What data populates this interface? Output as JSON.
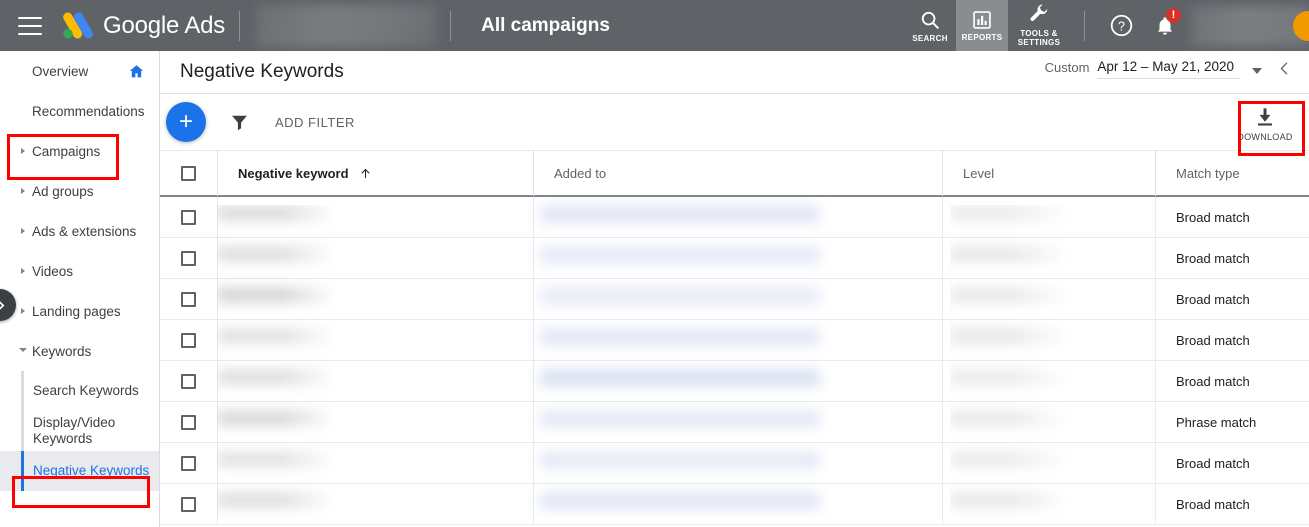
{
  "topbar": {
    "menu_icon": "hamburger-icon",
    "brand": "Google Ads",
    "brand_logo_icon": "google-ads-logo-icon",
    "account_section": "All campaigns",
    "items": [
      {
        "label": "SEARCH",
        "icon": "search-icon",
        "active": false
      },
      {
        "label": "REPORTS",
        "icon": "bar-chart-icon",
        "active": true
      },
      {
        "label": "TOOLS & SETTINGS",
        "icon": "wrench-icon",
        "active": false
      }
    ],
    "help_icon": "help-icon",
    "notifications_icon": "bell-icon",
    "notification_badge": "!",
    "avatar_icon": "avatar"
  },
  "sidebar": {
    "collapse_icon": "chevron-right-icon",
    "items": [
      {
        "label": "Overview",
        "expandable": false,
        "home_icon": "home-icon"
      },
      {
        "label": "Recommendations",
        "expandable": false
      },
      {
        "label": "Campaigns",
        "expandable": true,
        "expanded": false
      },
      {
        "label": "Ad groups",
        "expandable": true,
        "expanded": false
      },
      {
        "label": "Ads & extensions",
        "expandable": true,
        "expanded": false
      },
      {
        "label": "Videos",
        "expandable": true,
        "expanded": false
      },
      {
        "label": "Landing pages",
        "expandable": true,
        "expanded": false
      },
      {
        "label": "Keywords",
        "expandable": true,
        "expanded": true
      }
    ],
    "keywords_children": [
      {
        "label": "Search Keywords",
        "selected": false
      },
      {
        "label": "Display/Video Keywords",
        "selected": false
      },
      {
        "label": "Negative Keywords",
        "selected": true
      }
    ]
  },
  "page": {
    "title": "Negative Keywords",
    "date_range_label": "Custom",
    "date_range_value": "Apr 12 – May 21, 2020",
    "date_range_caret_icon": "chevron-down-icon",
    "date_prev_icon": "chevron-left-icon"
  },
  "toolbar": {
    "add_icon": "plus-icon",
    "filter_icon": "funnel-icon",
    "add_filter_label": "ADD FILTER",
    "download_icon": "download-icon",
    "download_label": "DOWNLOAD"
  },
  "table": {
    "select_all_checkbox": "unchecked",
    "columns": [
      {
        "label": "Negative keyword",
        "sorted": true,
        "sort_icon": "arrow-up-icon"
      },
      {
        "label": "Added to",
        "sorted": false
      },
      {
        "label": "Level",
        "sorted": false
      },
      {
        "label": "Match type",
        "sorted": false
      }
    ],
    "rows": [
      {
        "negative_keyword": "",
        "added_to": "",
        "level": "",
        "match_type": "Broad match"
      },
      {
        "negative_keyword": "",
        "added_to": "",
        "level": "",
        "match_type": "Broad match"
      },
      {
        "negative_keyword": "",
        "added_to": "",
        "level": "",
        "match_type": "Broad match"
      },
      {
        "negative_keyword": "",
        "added_to": "",
        "level": "",
        "match_type": "Broad match"
      },
      {
        "negative_keyword": "",
        "added_to": "",
        "level": "",
        "match_type": "Broad match"
      },
      {
        "negative_keyword": "",
        "added_to": "",
        "level": "",
        "match_type": "Phrase match"
      },
      {
        "negative_keyword": "",
        "added_to": "",
        "level": "",
        "match_type": "Broad match"
      },
      {
        "negative_keyword": "",
        "added_to": "",
        "level": "",
        "match_type": "Broad match"
      }
    ]
  },
  "annotations": {
    "color": "#ff0000",
    "boxes": [
      "Campaigns",
      "Negative Keywords",
      "DOWNLOAD"
    ]
  }
}
